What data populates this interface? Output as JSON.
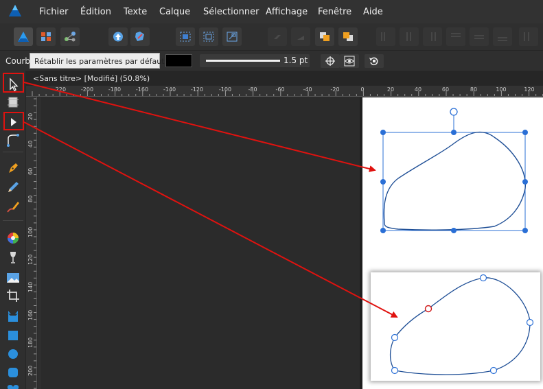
{
  "menubar": {
    "items": [
      "Fichier",
      "Édition",
      "Texte",
      "Calque",
      "Sélectionner",
      "Affichage",
      "Fenêtre",
      "Aide"
    ]
  },
  "contextbar": {
    "label": "Courb",
    "tooltip": "Rétablir les paramètres par défaut",
    "stroke_width": "1.5 pt",
    "fill_color": "#000000"
  },
  "document": {
    "title": "<Sans titre> [Modifié] (50.8%)"
  },
  "ruler": {
    "top_labels": [
      "-220",
      "-200",
      "-180",
      "-160",
      "-140",
      "-120",
      "-100",
      "-80",
      "-60",
      "-40",
      "-20",
      "0",
      "20",
      "40",
      "60",
      "80",
      "100",
      "120"
    ],
    "left_labels": [
      "20",
      "40",
      "60",
      "80",
      "100",
      "120",
      "140",
      "160",
      "180",
      "200"
    ]
  },
  "colors": {
    "accent_red": "#e0120f",
    "selection_blue": "#2a6fd6",
    "curve_blue": "#1f4f96"
  },
  "icons": {
    "app": "affinity-designer-logo",
    "tools": [
      "move-tool",
      "artboard-tool",
      "node-tool",
      "corner-tool",
      "pen-tool",
      "pencil-tool",
      "vector-brush-tool",
      "fill-tool",
      "transparency-tool",
      "place-image-tool",
      "crop-tool",
      "ellipse-tool-cat",
      "rectangle-tool",
      "ellipse-tool",
      "rounded-rect-tool",
      "heart-tool"
    ]
  }
}
